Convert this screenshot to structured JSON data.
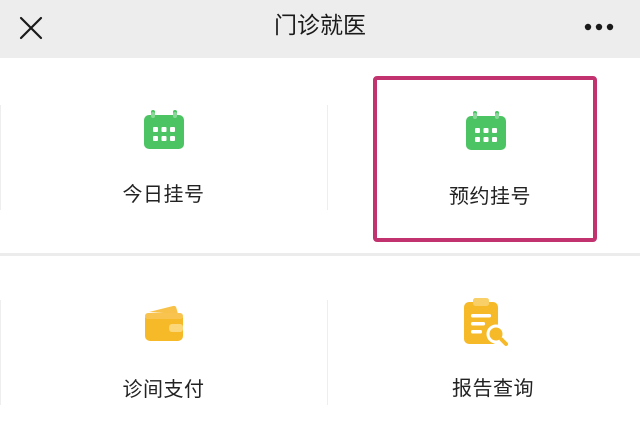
{
  "header": {
    "title": "门诊就医",
    "close_icon": "close-icon",
    "more_icon": "more-dots-icon"
  },
  "tiles": [
    {
      "label": "今日挂号",
      "icon": "calendar-icon",
      "color": "#4cc463"
    },
    {
      "label": "预约挂号",
      "icon": "calendar-icon",
      "color": "#4cc463"
    },
    {
      "label": "诊间支付",
      "icon": "wallet-icon",
      "color": "#f6b928"
    },
    {
      "label": "报告查询",
      "icon": "report-search-icon",
      "color": "#f6b928"
    }
  ],
  "highlight_color": "#c2326e"
}
